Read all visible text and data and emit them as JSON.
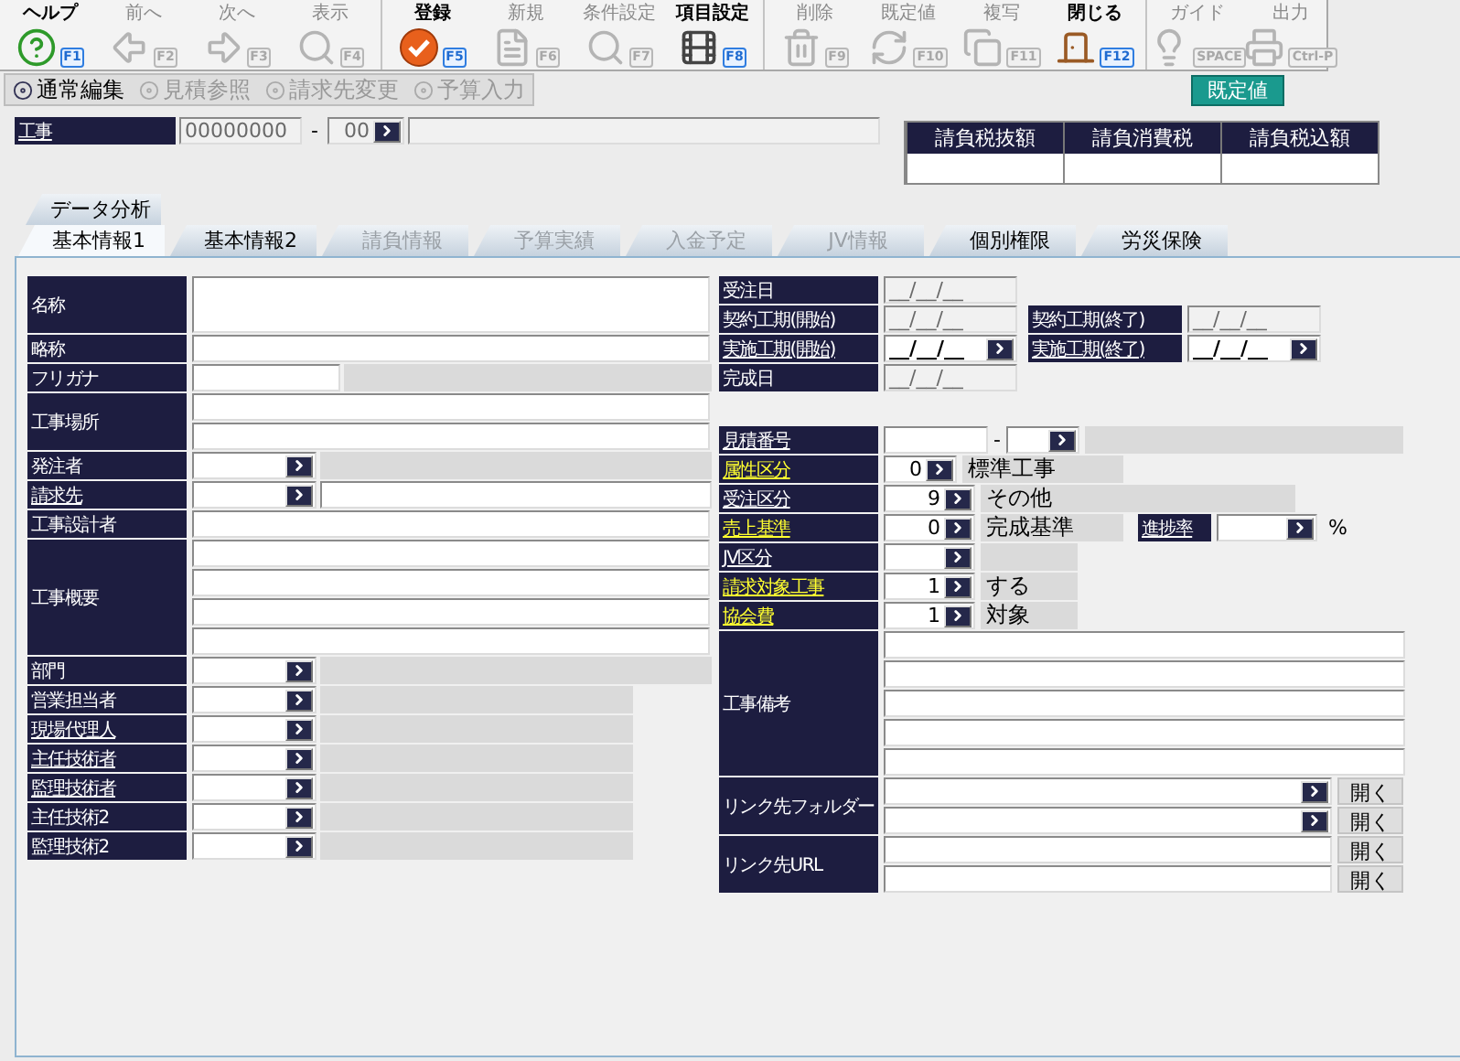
{
  "toolbar": {
    "groups": [
      [
        {
          "label": "ヘルプ",
          "key": "F1",
          "enabled": true
        },
        {
          "label": "前へ",
          "key": "F2",
          "enabled": false
        },
        {
          "label": "次へ",
          "key": "F3",
          "enabled": false
        },
        {
          "label": "表示",
          "key": "F4",
          "enabled": false
        }
      ],
      [
        {
          "label": "登録",
          "key": "F5",
          "enabled": true
        },
        {
          "label": "新規",
          "key": "F6",
          "enabled": false
        },
        {
          "label": "条件設定",
          "key": "F7",
          "enabled": false
        },
        {
          "label": "項目設定",
          "key": "F8",
          "enabled": true
        }
      ],
      [
        {
          "label": "削除",
          "key": "F9",
          "enabled": false
        },
        {
          "label": "既定値",
          "key": "F10",
          "enabled": false
        },
        {
          "label": "複写",
          "key": "F11",
          "enabled": false
        },
        {
          "label": "閉じる",
          "key": "F12",
          "enabled": true
        }
      ],
      [
        {
          "label": "ガイド",
          "key": "SPACE",
          "enabled": false
        },
        {
          "label": "出力",
          "key": "Ctrl-P",
          "enabled": false
        }
      ]
    ]
  },
  "modes": [
    {
      "label": "通常編集",
      "enabled": true
    },
    {
      "label": "見積参照",
      "enabled": false
    },
    {
      "label": "請求先変更",
      "enabled": false
    },
    {
      "label": "予算入力",
      "enabled": false
    }
  ],
  "default_button": "既定値",
  "header": {
    "label": "工事",
    "link": true,
    "code": "00000000",
    "separator": "-",
    "branch": "00"
  },
  "tax_table": {
    "columns": [
      "請負税抜額",
      "請負消費税",
      "請負税込額"
    ]
  },
  "top_tabs": [
    {
      "label": "データ分析",
      "selected": false
    }
  ],
  "tabs": [
    {
      "label": "基本情報1",
      "selected": true,
      "disabled": false
    },
    {
      "label": "基本情報2",
      "selected": false,
      "disabled": false
    },
    {
      "label": "請負情報",
      "selected": false,
      "disabled": true
    },
    {
      "label": "予算実績",
      "selected": false,
      "disabled": true
    },
    {
      "label": "入金予定",
      "selected": false,
      "disabled": true
    },
    {
      "label": "JV情報",
      "selected": false,
      "disabled": true
    },
    {
      "label": "個別権限",
      "selected": false,
      "disabled": false
    },
    {
      "label": "労災保険",
      "selected": false,
      "disabled": false
    }
  ],
  "left_rows": [
    {
      "label": "名称",
      "link": false,
      "kind": "tall"
    },
    {
      "label": "略称",
      "link": false,
      "kind": "text"
    },
    {
      "label": "フリガナ",
      "link": false,
      "kind": "kana"
    },
    {
      "label": "工事場所",
      "link": false,
      "kind": "text_double"
    },
    {
      "label": "発注者",
      "link": false,
      "kind": "lookup"
    },
    {
      "label": "請求先",
      "link": true,
      "kind": "lookup_input"
    },
    {
      "label": "工事設計者",
      "link": false,
      "kind": "text"
    },
    {
      "label": "工事概要",
      "link": false,
      "kind": "text_quad"
    },
    {
      "label": "部門",
      "link": false,
      "kind": "lookup"
    },
    {
      "label": "営業担当者",
      "link": false,
      "kind": "lookup_short"
    },
    {
      "label": "現場代理人",
      "link": true,
      "kind": "lookup_short"
    },
    {
      "label": "主任技術者",
      "link": true,
      "kind": "lookup_short"
    },
    {
      "label": "監理技術者",
      "link": true,
      "kind": "lookup_short"
    },
    {
      "label": "主任技術2",
      "link": false,
      "kind": "lookup_short"
    },
    {
      "label": "監理技術2",
      "link": false,
      "kind": "lookup_short"
    }
  ],
  "dates": [
    {
      "label": "受注日",
      "link": false,
      "value": "__/__/__",
      "editable": false
    },
    {
      "label": "契約工期(開始)",
      "link": false,
      "value": "__/__/__",
      "editable": false,
      "pair": {
        "label": "契約工期(終了)",
        "link": false,
        "value": "__/__/__",
        "editable": false
      }
    },
    {
      "label": "実施工期(開始)",
      "link": true,
      "value": "__/__/__",
      "editable": true,
      "pair": {
        "label": "実施工期(終了)",
        "link": true,
        "value": "__/__/__",
        "editable": true
      }
    },
    {
      "label": "完成日",
      "link": false,
      "value": "__/__/__",
      "editable": false
    }
  ],
  "details": [
    {
      "label": "見積番号",
      "link": true,
      "accent": false,
      "kind": "estimate",
      "separator": "-"
    },
    {
      "label": "属性区分",
      "link": true,
      "accent": true,
      "kind": "code",
      "value": "0",
      "display": "標準工事"
    },
    {
      "label": "受注区分",
      "link": true,
      "accent": false,
      "kind": "code",
      "value": "9",
      "display": "その他"
    },
    {
      "label": "売上基準",
      "link": true,
      "accent": true,
      "kind": "code_progress",
      "value": "0",
      "display": "完成基準",
      "progress_label": "進捗率",
      "unit": "%"
    },
    {
      "label": "JV区分",
      "link": true,
      "accent": false,
      "kind": "code"
    },
    {
      "label": "請求対象工事",
      "link": true,
      "accent": true,
      "kind": "code",
      "value": "1",
      "display": "する"
    },
    {
      "label": "協会費",
      "link": true,
      "accent": true,
      "kind": "code",
      "value": "1",
      "display": "対象"
    },
    {
      "label": "工事備考",
      "link": false,
      "accent": false,
      "kind": "memo"
    },
    {
      "label": "リンク先フォルダー",
      "link": false,
      "accent": false,
      "kind": "folder",
      "buttons": [
        "開く",
        "開く"
      ]
    },
    {
      "label": "リンク先URL",
      "link": false,
      "accent": false,
      "kind": "url",
      "buttons": [
        "開く",
        "開く"
      ]
    }
  ]
}
